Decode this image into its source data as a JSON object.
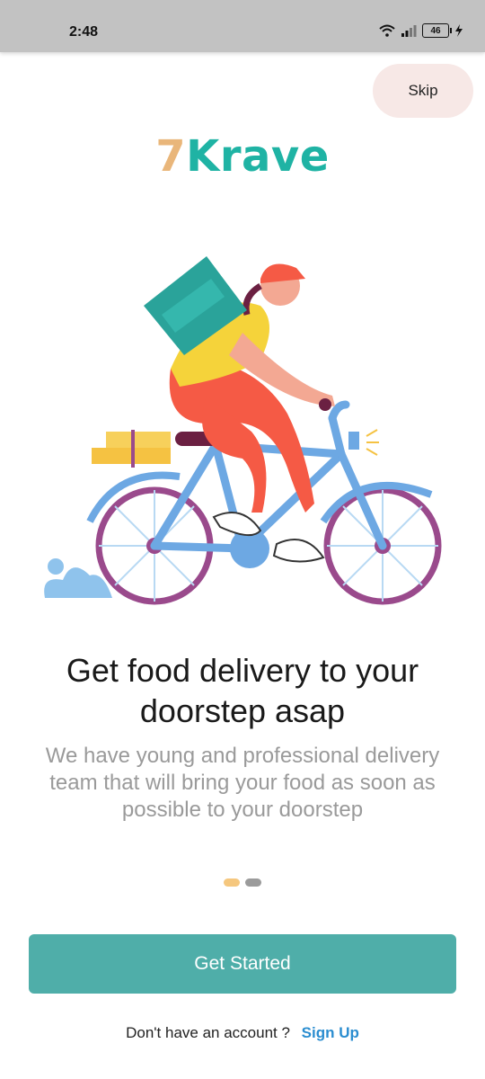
{
  "status_bar": {
    "time": "2:48",
    "battery": "46",
    "icons": [
      "wifi-icon",
      "signal-icon",
      "battery-icon",
      "charging-icon"
    ]
  },
  "skip_label": "Skip",
  "logo": {
    "number": "7",
    "word": "Krave"
  },
  "illustration": "delivery-cyclist-illustration",
  "headline": "Get food delivery to your doorstep asap",
  "subtext": "We have young and professional delivery team that will bring your food as soon as possible to your doorstep",
  "pager": {
    "pages": 2,
    "active": 1
  },
  "get_started_label": "Get Started",
  "signup": {
    "prompt": "Don't have an account ?",
    "link": "Sign Up"
  },
  "colors": {
    "primary": "#4faea9",
    "logo_accent": "#e9b67a",
    "logo_text": "#1fb3a4",
    "link": "#2a8dd0",
    "skip_bg": "#f7e8e6"
  }
}
